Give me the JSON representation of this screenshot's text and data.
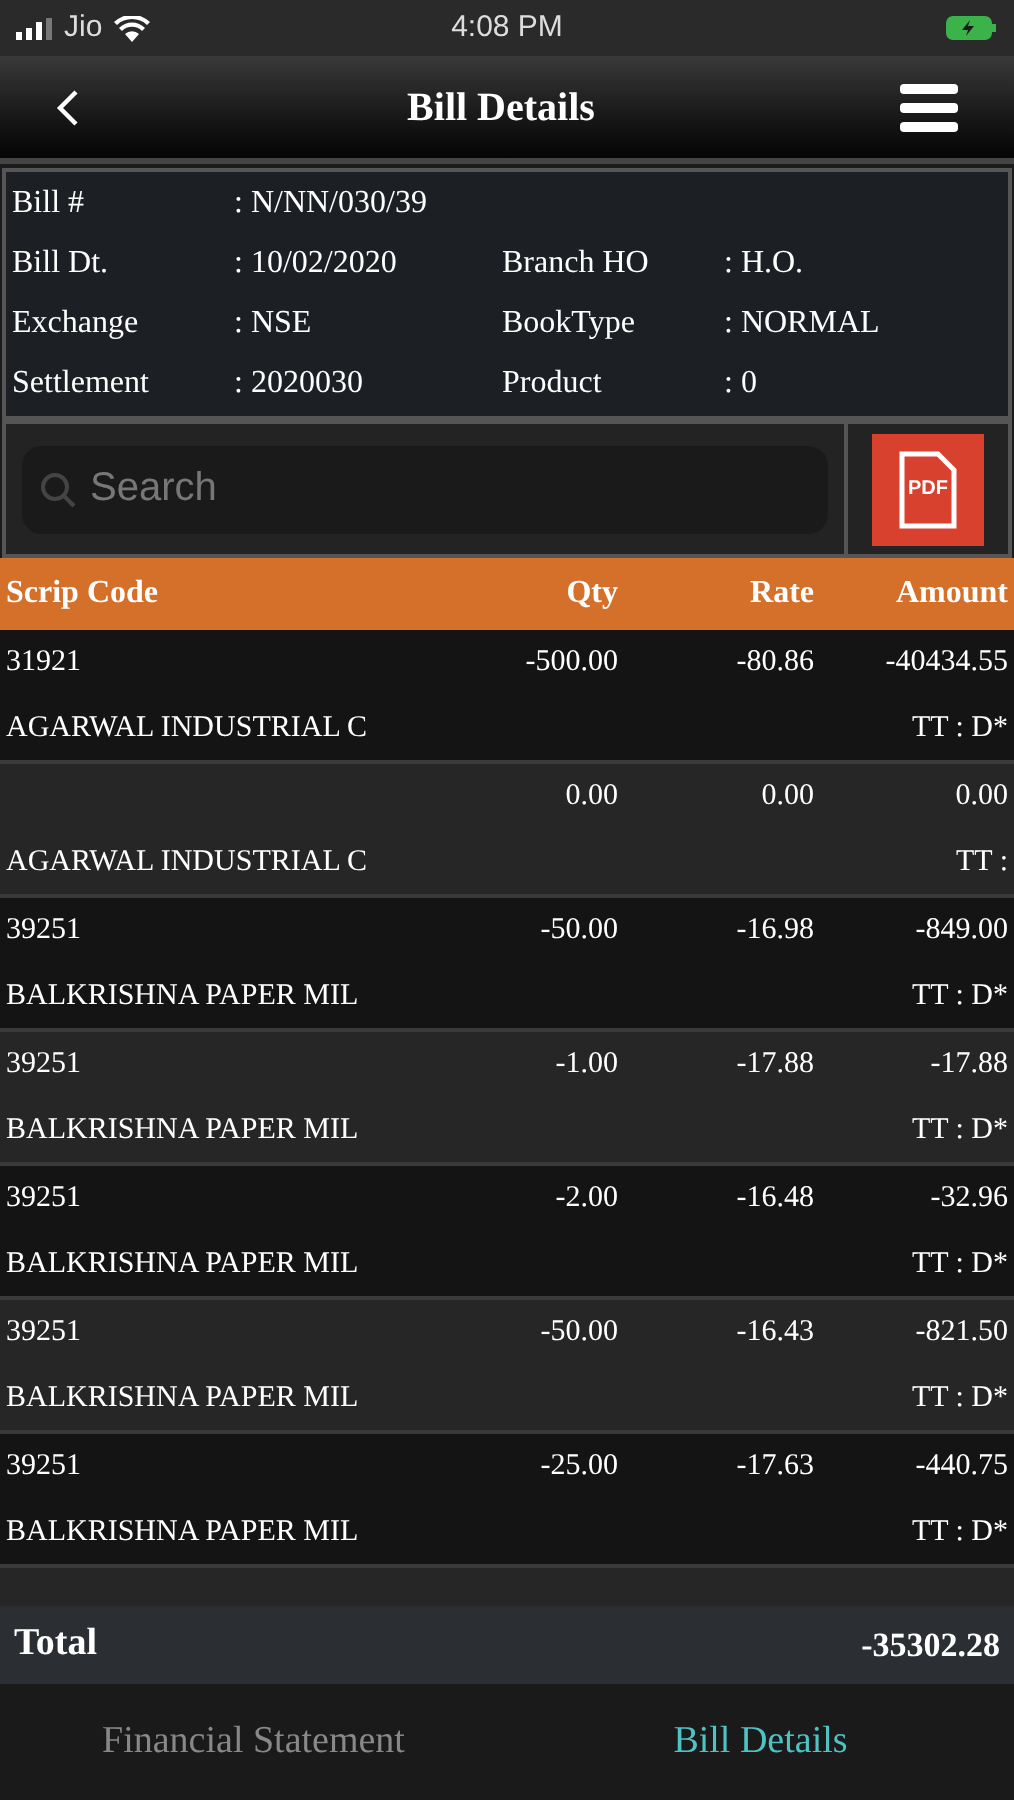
{
  "status_bar": {
    "carrier": "Jio",
    "time": "4:08 PM"
  },
  "nav": {
    "title": "Bill Details"
  },
  "info": [
    {
      "label": "Bill #",
      "value": ": N/NN/030/39"
    },
    {
      "label": "Bill Dt.",
      "value": ": 10/02/2020"
    },
    {
      "label": "Branch HO",
      "value": ": H.O."
    },
    {
      "label": "Exchange",
      "value": ": NSE"
    },
    {
      "label": "BookType",
      "value": ": NORMAL"
    },
    {
      "label": "Settlement",
      "value": ": 2020030"
    },
    {
      "label": "Product",
      "value": ": 0"
    }
  ],
  "search": {
    "placeholder": "Search"
  },
  "pdf_button": {
    "label": "PDF"
  },
  "table": {
    "columns": [
      "Scrip Code",
      "Qty",
      "Rate",
      "Amount"
    ],
    "rows": [
      {
        "code": "31921",
        "qty": "-500.00",
        "rate": "-80.86",
        "amount": "-40434.55",
        "name": "AGARWAL INDUSTRIAL C",
        "tt": "TT : D*"
      },
      {
        "code": "",
        "qty": "0.00",
        "rate": "0.00",
        "amount": "0.00",
        "name": "AGARWAL INDUSTRIAL C",
        "tt": "TT :"
      },
      {
        "code": "39251",
        "qty": "-50.00",
        "rate": "-16.98",
        "amount": "-849.00",
        "name": "BALKRISHNA PAPER MIL",
        "tt": "TT : D*"
      },
      {
        "code": "39251",
        "qty": "-1.00",
        "rate": "-17.88",
        "amount": "-17.88",
        "name": "BALKRISHNA PAPER MIL",
        "tt": "TT : D*"
      },
      {
        "code": "39251",
        "qty": "-2.00",
        "rate": "-16.48",
        "amount": "-32.96",
        "name": "BALKRISHNA PAPER MIL",
        "tt": "TT : D*"
      },
      {
        "code": "39251",
        "qty": "-50.00",
        "rate": "-16.43",
        "amount": "-821.50",
        "name": "BALKRISHNA PAPER MIL",
        "tt": "TT : D*"
      },
      {
        "code": "39251",
        "qty": "-25.00",
        "rate": "-17.63",
        "amount": "-440.75",
        "name": "BALKRISHNA PAPER MIL",
        "tt": "TT : D*"
      }
    ]
  },
  "total": {
    "label": "Total",
    "value": "-35302.28"
  },
  "tabs": [
    {
      "label": "Financial Statement",
      "selected": false
    },
    {
      "label": "Bill Details",
      "selected": true
    }
  ]
}
